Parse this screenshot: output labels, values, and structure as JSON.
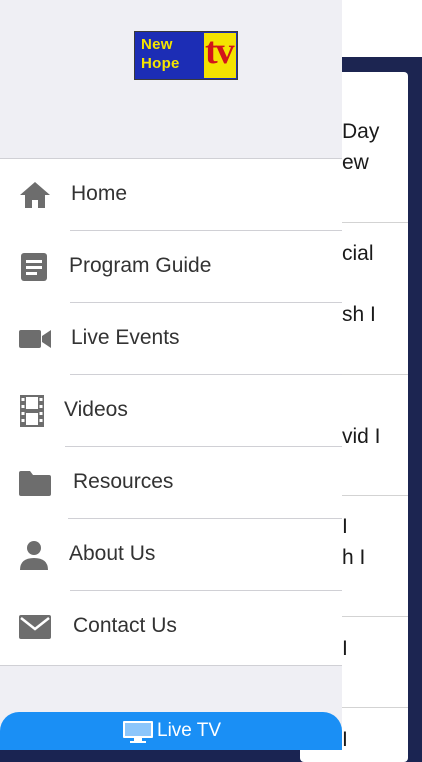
{
  "background": {
    "cells": [
      {
        "lines": [
          "Day",
          "ew"
        ]
      },
      {
        "lines": [
          "cial",
          "sh I"
        ]
      },
      {
        "lines": [
          "vid I"
        ]
      },
      {
        "lines": [
          "I",
          "h I"
        ]
      },
      {
        "lines": [
          "I"
        ]
      },
      {
        "lines": [
          "I"
        ]
      }
    ]
  },
  "logo": {
    "line1": "New",
    "line2": "Hope",
    "tv": "tv"
  },
  "menu": {
    "items": [
      {
        "label": "Home",
        "icon": "home-icon"
      },
      {
        "label": "Program Guide",
        "icon": "document-icon"
      },
      {
        "label": "Live Events",
        "icon": "video-camera-icon"
      },
      {
        "label": "Videos",
        "icon": "film-icon"
      },
      {
        "label": "Resources",
        "icon": "folder-icon"
      },
      {
        "label": "About Us",
        "icon": "person-icon"
      },
      {
        "label": "Contact Us",
        "icon": "envelope-icon"
      }
    ]
  },
  "live_button": {
    "label": "Live TV",
    "icon": "television-icon"
  },
  "colors": {
    "accent": "#1a8ff5",
    "navy": "#1c2551",
    "icon_gray": "#6d6d6d"
  }
}
